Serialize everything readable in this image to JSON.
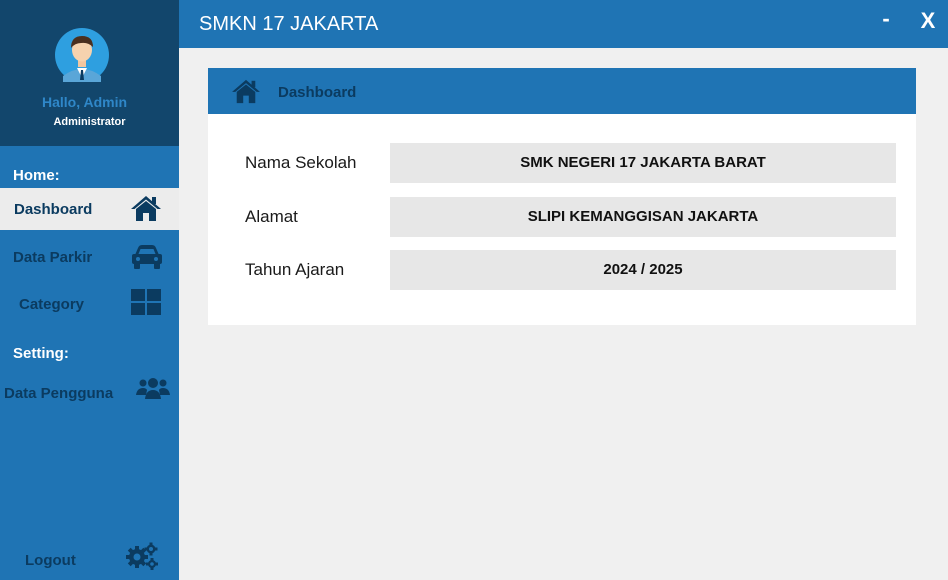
{
  "window": {
    "title": "SMKN 17 JAKARTA",
    "minimize_label": "-",
    "close_label": "X"
  },
  "profile": {
    "greeting": "Hallo, Admin",
    "role": "Administrator"
  },
  "sidebar": {
    "home_section": "Home:",
    "setting_section": "Setting:",
    "items": [
      {
        "label": "Dashboard",
        "icon": "home-icon"
      },
      {
        "label": "Data Parkir",
        "icon": "car-icon"
      },
      {
        "label": "Category",
        "icon": "grid-icon"
      },
      {
        "label": "Data Pengguna",
        "icon": "users-icon"
      }
    ],
    "logout_label": "Logout"
  },
  "dashboard": {
    "header": "Dashboard",
    "rows": [
      {
        "label": "Nama Sekolah",
        "value": "SMK NEGERI 17 JAKARTA BARAT"
      },
      {
        "label": "Alamat",
        "value": "SLIPI KEMANGGISAN JAKARTA"
      },
      {
        "label": "Tahun Ajaran",
        "value": "2024 / 2025"
      }
    ]
  },
  "colors": {
    "primary": "#1f74b4",
    "profile_bg": "#12466c",
    "icon": "#0b3b60",
    "content_bg": "#f0f0f0"
  }
}
